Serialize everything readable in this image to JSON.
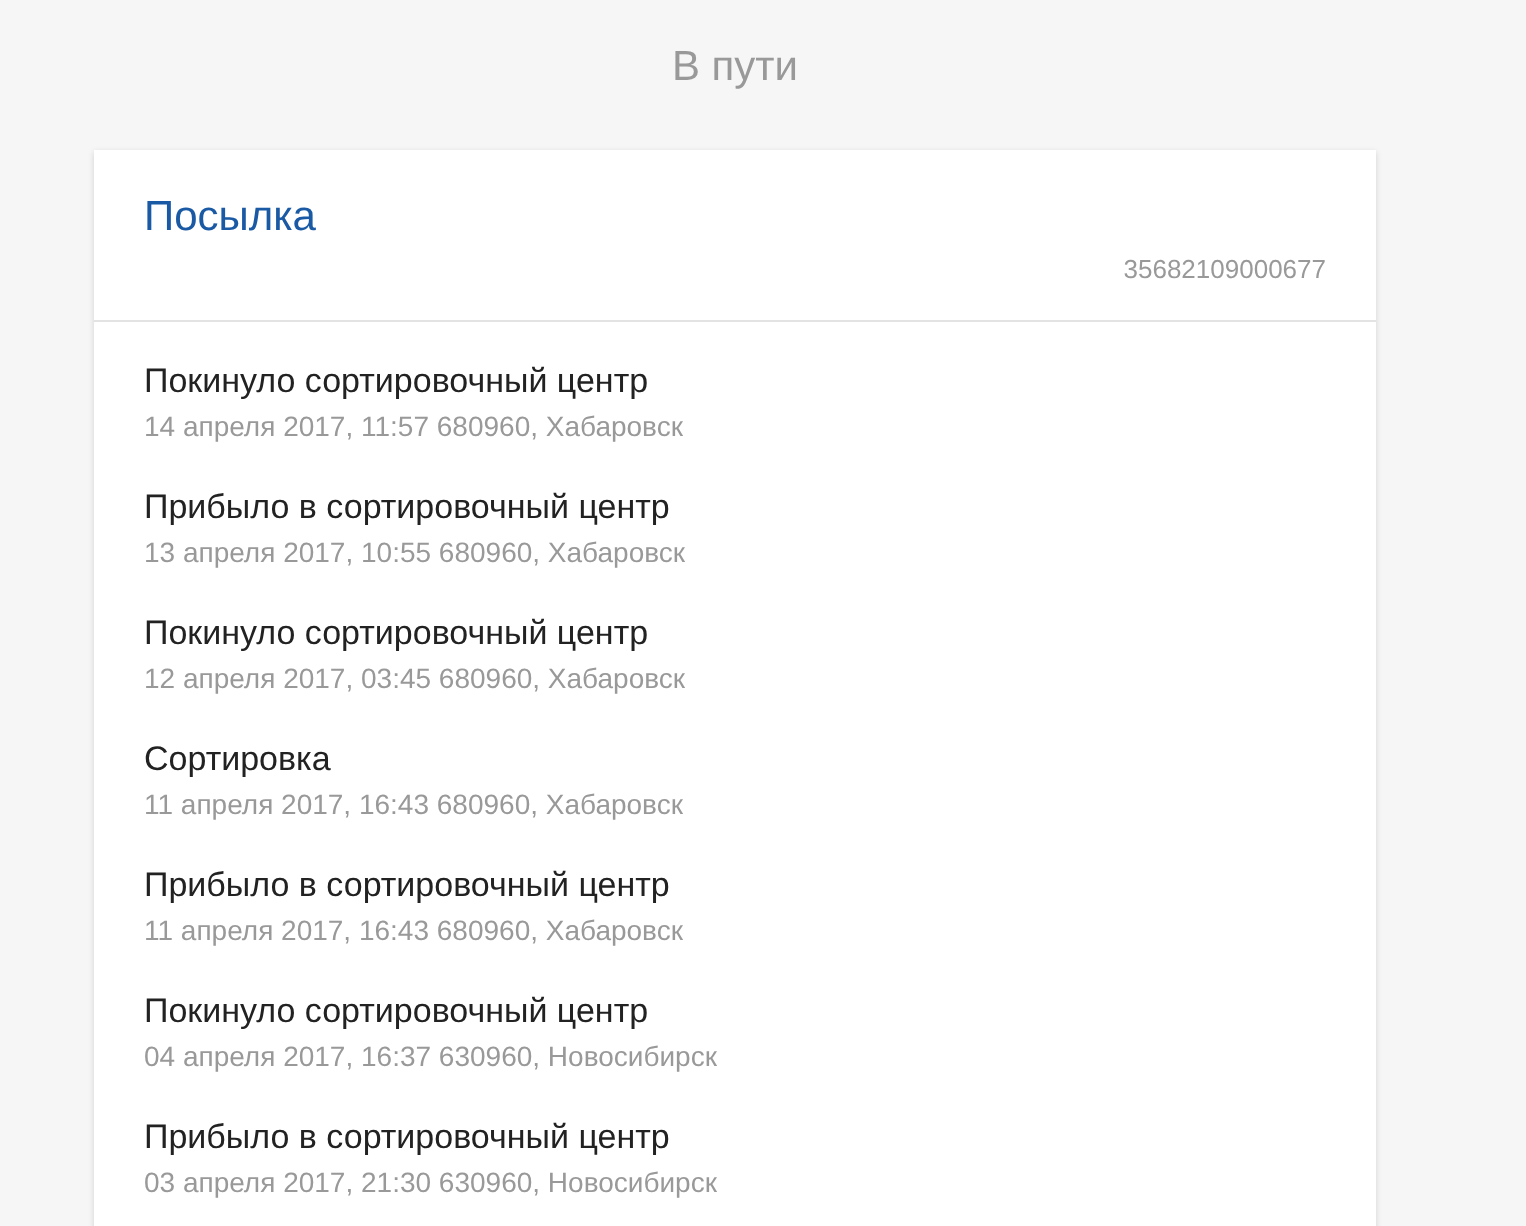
{
  "status_title": "В пути",
  "parcel": {
    "title": "Посылка",
    "tracking_number": "35682109000677"
  },
  "events": [
    {
      "title": "Покинуло сортировочный центр",
      "details": "14 апреля 2017, 11:57 680960, Хабаровск"
    },
    {
      "title": "Прибыло в сортировочный центр",
      "details": "13 апреля 2017, 10:55 680960, Хабаровск"
    },
    {
      "title": "Покинуло сортировочный центр",
      "details": "12 апреля 2017, 03:45 680960, Хабаровск"
    },
    {
      "title": "Сортировка",
      "details": "11 апреля 2017, 16:43 680960, Хабаровск"
    },
    {
      "title": "Прибыло в сортировочный центр",
      "details": "11 апреля 2017, 16:43 680960, Хабаровск"
    },
    {
      "title": "Покинуло сортировочный центр",
      "details": "04 апреля 2017, 16:37 630960, Новосибирск"
    },
    {
      "title": "Прибыло в сортировочный центр",
      "details": "03 апреля 2017, 21:30 630960, Новосибирск"
    }
  ]
}
